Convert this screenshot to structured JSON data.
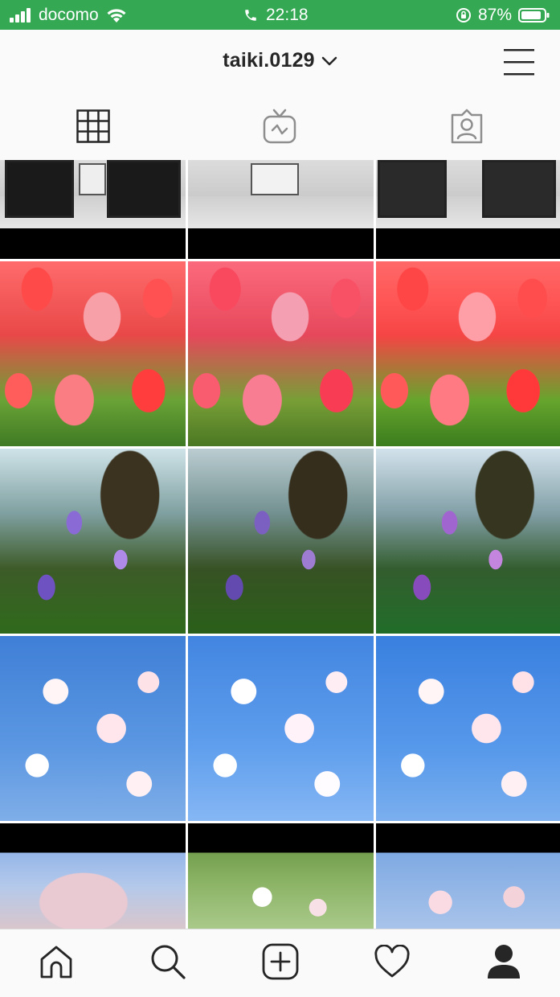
{
  "status_bar": {
    "carrier": "docomo",
    "time": "22:18",
    "battery_percent": "87%",
    "signal_bars": 4,
    "battery_level": 0.87,
    "background_color": "#34a853"
  },
  "header": {
    "username": "taiki.0129",
    "dropdown_icon": "chevron-down-icon",
    "menu_icon": "hamburger-menu-icon"
  },
  "tabs": [
    {
      "name": "grid-view",
      "icon": "grid-icon",
      "selected": true
    },
    {
      "name": "igtv",
      "icon": "igtv-icon",
      "selected": false
    },
    {
      "name": "tagged",
      "icon": "tagged-icon",
      "selected": false
    }
  ],
  "grid": {
    "rows": [
      [
        "room interior photo",
        "room interior photo",
        "room interior photo"
      ],
      [
        "red tulips",
        "pink tulips",
        "red tulips"
      ],
      [
        "purple wildflowers",
        "purple wildflowers",
        "purple wildflowers"
      ],
      [
        "cherry blossoms",
        "cherry blossoms",
        "cherry blossoms"
      ],
      [
        "cherry tree",
        "cherry blossoms",
        "cherry tree"
      ]
    ]
  },
  "bottom_nav": [
    {
      "name": "home",
      "icon": "home-icon"
    },
    {
      "name": "search",
      "icon": "search-icon"
    },
    {
      "name": "new-post",
      "icon": "add-post-icon"
    },
    {
      "name": "activity",
      "icon": "heart-icon"
    },
    {
      "name": "profile",
      "icon": "profile-icon",
      "active": true
    }
  ]
}
